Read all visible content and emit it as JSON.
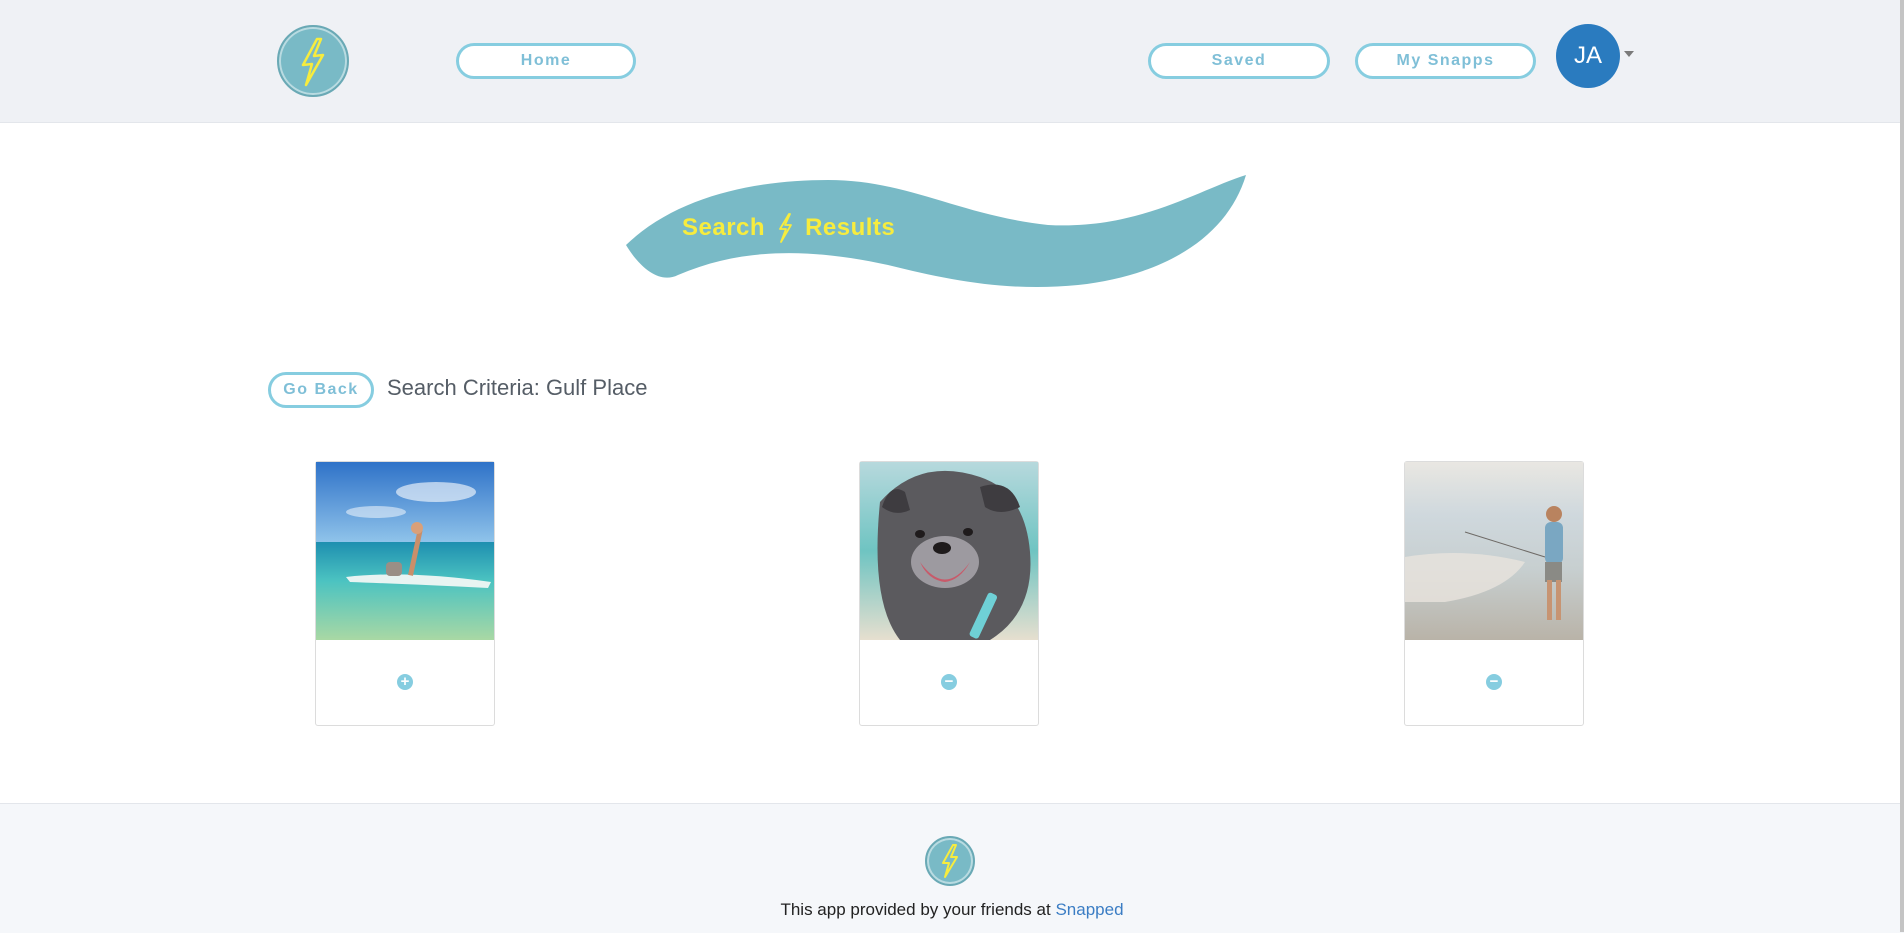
{
  "header": {
    "logo_icon": "lightning-bolt-icon",
    "nav": {
      "home_label": "Home",
      "saved_label": "Saved",
      "my_snapps_label": "My Snapps"
    },
    "user": {
      "initials": "JA",
      "dropdown_icon": "caret-down-icon"
    }
  },
  "hero": {
    "title_left": "Search",
    "title_icon": "lightning-bolt-icon",
    "title_right": "Results"
  },
  "search": {
    "go_back_label": "Go Back",
    "criteria_text": "Search Criteria: Gulf Place"
  },
  "results": [
    {
      "image": "paddleboard-woman-with-dog-photo",
      "action_icon": "plus-circle-icon",
      "action_symbol": "+"
    },
    {
      "image": "smiling-dog-at-beach-photo",
      "action_icon": "minus-circle-icon",
      "action_symbol": "−"
    },
    {
      "image": "boy-fishing-at-shore-photo",
      "action_icon": "minus-circle-icon",
      "action_symbol": "−"
    }
  ],
  "footer": {
    "text": "This app provided by your friends at",
    "link_label": "Snapped"
  },
  "colors": {
    "accent": "#86cde0",
    "brand_teal": "#79bac6",
    "title_yellow": "#f7ec3e",
    "avatar_blue": "#2a7bbf",
    "link_blue": "#3b7dc4"
  }
}
